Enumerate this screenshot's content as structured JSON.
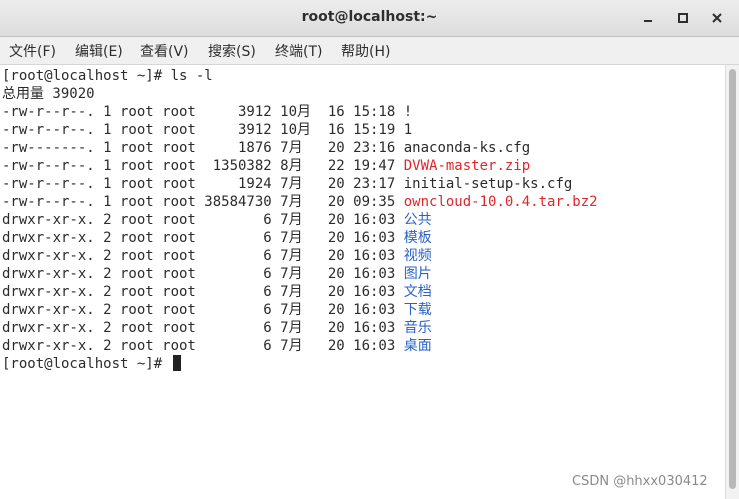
{
  "window": {
    "title": "root@localhost:~",
    "controls": [
      "minimize-icon",
      "maximize-icon",
      "close-icon"
    ]
  },
  "menu": [
    {
      "label": "文件(F)"
    },
    {
      "label": "编辑(E)"
    },
    {
      "label": "查看(V)"
    },
    {
      "label": "搜索(S)"
    },
    {
      "label": "终端(T)"
    },
    {
      "label": "帮助(H)"
    }
  ],
  "terminal": {
    "lines": [
      {
        "prefix": "[root@localhost ~]# ls -l",
        "name": ""
      },
      {
        "prefix": "总用量 39020",
        "name": ""
      },
      {
        "prefix": "-rw-r--r--. 1 root root     3912 10月  16 15:18 ",
        "name": "!"
      },
      {
        "prefix": "-rw-r--r--. 1 root root     3912 10月  16 15:19 ",
        "name": "1"
      },
      {
        "prefix": "-rw-------. 1 root root     1876 7月   20 23:16 ",
        "name": "anaconda-ks.cfg"
      },
      {
        "prefix": "-rw-r--r--. 1 root root  1350382 8月   22 19:47 ",
        "name": "DVWA-master.zip"
      },
      {
        "prefix": "-rw-r--r--. 1 root root     1924 7月   20 23:17 ",
        "name": "initial-setup-ks.cfg"
      },
      {
        "prefix": "-rw-r--r--. 1 root root 38584730 7月   20 09:35 ",
        "name": "owncloud-10.0.4.tar.bz2"
      },
      {
        "prefix": "drwxr-xr-x. 2 root root        6 7月   20 16:03 ",
        "name": "公共"
      },
      {
        "prefix": "drwxr-xr-x. 2 root root        6 7月   20 16:03 ",
        "name": "模板"
      },
      {
        "prefix": "drwxr-xr-x. 2 root root        6 7月   20 16:03 ",
        "name": "视频"
      },
      {
        "prefix": "drwxr-xr-x. 2 root root        6 7月   20 16:03 ",
        "name": "图片"
      },
      {
        "prefix": "drwxr-xr-x. 2 root root        6 7月   20 16:03 ",
        "name": "文档"
      },
      {
        "prefix": "drwxr-xr-x. 2 root root        6 7月   20 16:03 ",
        "name": "下载"
      },
      {
        "prefix": "drwxr-xr-x. 2 root root        6 7月   20 16:03 ",
        "name": "音乐"
      },
      {
        "prefix": "drwxr-xr-x. 2 root root        6 7月   20 16:03 ",
        "name": "桌面"
      },
      {
        "prefix": "[root@localhost ~]# ",
        "name": ""
      }
    ],
    "name_colors": {
      "plain": "#2b2b2b",
      "archive": "#e0262b",
      "directory": "#2a62c9"
    }
  },
  "watermark": "CSDN @hhxx030412"
}
